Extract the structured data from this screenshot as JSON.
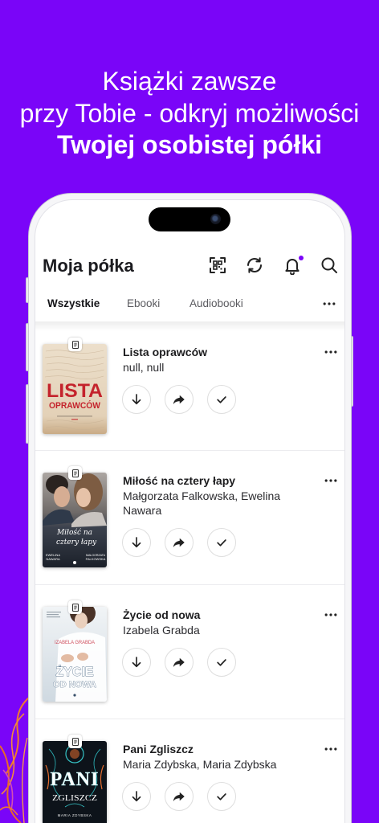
{
  "promo": {
    "line1": "Książki zawsze",
    "line2": "przy Tobie - odkryj możliwości",
    "line3": "Twojej osobistej półki"
  },
  "colors": {
    "background": "#7a05f8",
    "notification_dot": "#7a05f8",
    "text_primary": "#1d1d1f",
    "cover_red": "#c4232c"
  },
  "header": {
    "title": "Moja półka",
    "icons": [
      "qr-code-icon",
      "sync-icon",
      "bell-icon",
      "search-icon"
    ],
    "notification_badge": true
  },
  "tabs": [
    {
      "label": "Wszystkie",
      "selected": true
    },
    {
      "label": "Ebooki",
      "selected": false
    },
    {
      "label": "Audiobooki",
      "selected": false
    }
  ],
  "tabs_more_icon": "more-horizontal-icon",
  "book_actions": [
    "download-icon",
    "share-icon",
    "check-icon"
  ],
  "books": [
    {
      "title": "Lista oprawców",
      "authors": "null, null",
      "badge_icon": "document-icon",
      "cover_text": [
        "LISTA",
        "OPRAWCÓW"
      ]
    },
    {
      "title": "Miłość na cztery łapy",
      "authors": "Małgorzata Falkowska, Ewelina Nawara",
      "badge_icon": "document-icon",
      "cover_text": [
        "Miłość na",
        "cztery łapy",
        "EWELINA",
        "NAWARA",
        "MAŁGORZATA",
        "FALKOWSKA"
      ]
    },
    {
      "title": "Życie od nowa",
      "authors": "Izabela Grabda",
      "badge_icon": "document-icon",
      "cover_text": [
        "IZABELA GRABDA",
        "ŻYCIE",
        "OD NOWA"
      ]
    },
    {
      "title": "Pani Zgliszcz",
      "authors": "Maria Zdybska, Maria Zdybska",
      "badge_icon": "document-icon",
      "cover_text": [
        "PANI",
        "ZGLISZCZ",
        "MARIA ZDYBSKA"
      ]
    }
  ]
}
